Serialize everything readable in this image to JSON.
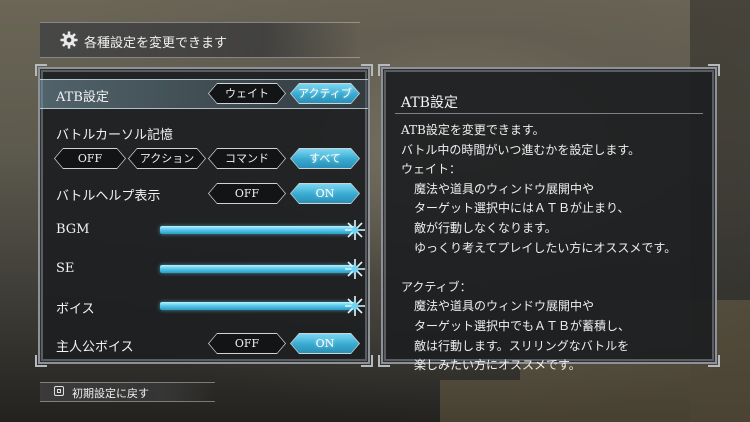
{
  "header": {
    "title": "各種設定を変更できます",
    "icon": "gear-icon"
  },
  "settings": {
    "atb": {
      "label": "ATB設定",
      "options": [
        "ウェイト",
        "アクティブ"
      ],
      "selected": "アクティブ"
    },
    "cursor_memory": {
      "label": "バトルカーソル記憶",
      "options": [
        "OFF",
        "アクション",
        "コマンド",
        "すべて"
      ],
      "selected": "すべて"
    },
    "battle_help": {
      "label": "バトルヘルプ表示",
      "options": [
        "OFF",
        "ON"
      ],
      "selected": "ON"
    },
    "bgm": {
      "label": "BGM",
      "level": 1.0
    },
    "se": {
      "label": "SE",
      "level": 1.0
    },
    "voice": {
      "label": "ボイス",
      "level": 1.0
    },
    "hero_voice": {
      "label": "主人公ボイス",
      "options": [
        "OFF",
        "ON"
      ],
      "selected": "ON"
    }
  },
  "description": {
    "title": "ATB設定",
    "lines": [
      "ATB設定を変更できます。",
      "バトル中の時間がいつ進むかを設定します。",
      "ウェイト：",
      "魔法や道具のウィンドウ展開中や",
      "ターゲット選択中にはＡＴＢが止まり、",
      "敵が行動しなくなります。",
      "ゆっくり考えてプレイしたい方にオススメです。",
      "",
      "アクティブ：",
      "魔法や道具のウィンドウ展開中や",
      "ターゲット選択中でもＡＴＢが蓄積し、",
      "敵は行動します。スリリングなバトルを",
      "楽しみたい方にオススメです。"
    ]
  },
  "footer": {
    "label": "初期設定に戻す",
    "icon": "square-button-icon"
  },
  "colors": {
    "accent": "#38a9cf",
    "panel": "#1c1e21",
    "border": "#8e9297"
  }
}
